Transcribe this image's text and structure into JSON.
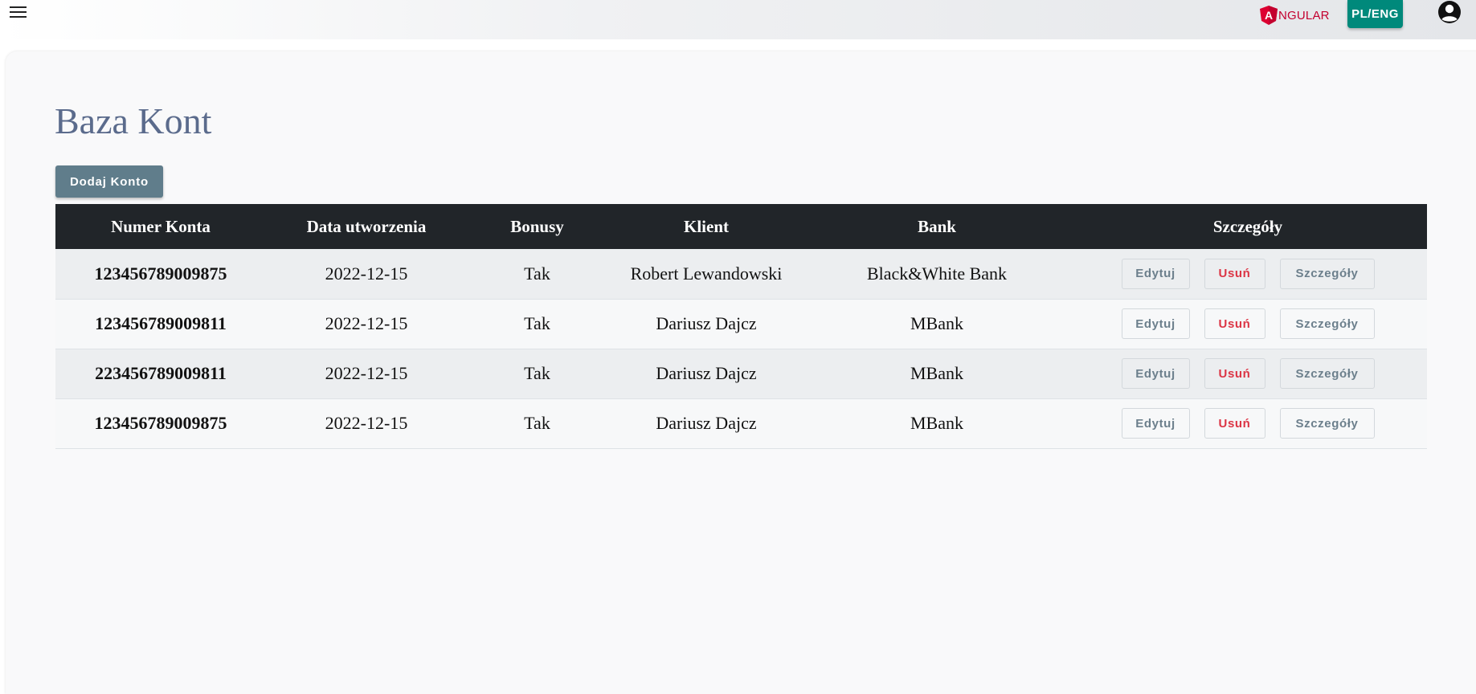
{
  "header": {
    "menu_icon": "hamburger-menu-icon",
    "logo_text": "NGULAR",
    "logo_icon": "angular-shield-icon",
    "logo_letter": "A",
    "lang_label": "PL/ENG",
    "avatar_icon": "account-circle-icon",
    "colors": {
      "angular_red": "#c3002f",
      "lang_button": "#00897b"
    }
  },
  "page": {
    "title": "Baza Kont",
    "add_button": "Dodaj Konto",
    "add_button_color": "#607d8b"
  },
  "table": {
    "columns": [
      "Numer Konta",
      "Data utworzenia",
      "Bonusy",
      "Klient",
      "Bank",
      "Szczegóły"
    ],
    "action_labels": {
      "edit": "Edytuj",
      "delete": "Usuń",
      "details": "Szczegóły"
    },
    "rows": [
      {
        "number": "123456789009875",
        "date": "2022-12-15",
        "bonus": "Tak",
        "client": "Robert Lewandowski",
        "bank": "Black&White Bank"
      },
      {
        "number": "123456789009811",
        "date": "2022-12-15",
        "bonus": "Tak",
        "client": "Dariusz Dajcz",
        "bank": "MBank"
      },
      {
        "number": "223456789009811",
        "date": "2022-12-15",
        "bonus": "Tak",
        "client": "Dariusz Dajcz",
        "bank": "MBank"
      },
      {
        "number": "123456789009875",
        "date": "2022-12-15",
        "bonus": "Tak",
        "client": "Dariusz Dajcz",
        "bank": "MBank"
      }
    ]
  }
}
